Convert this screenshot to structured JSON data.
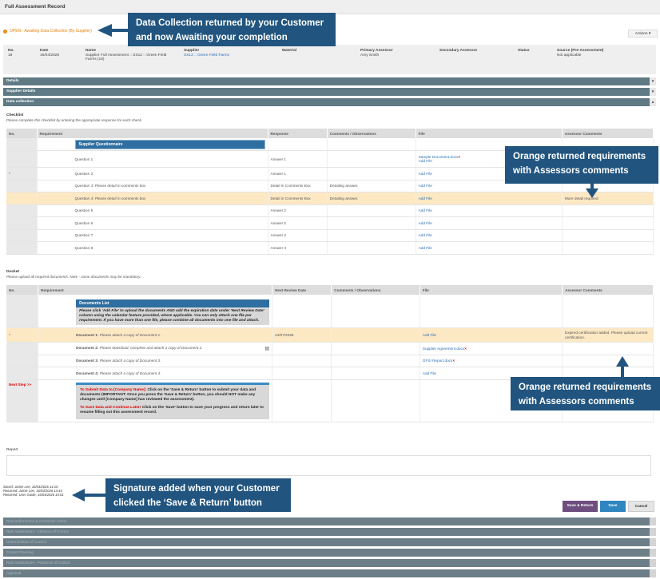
{
  "header": {
    "title": "Full Assessment Record"
  },
  "status": {
    "icon": "info-icon",
    "text": "OPEN - Awaiting Data Collection (By Supplier)"
  },
  "actions_label": "Actions ▾",
  "summary": {
    "no_label": "No.",
    "no_value": "18",
    "date_label": "Date",
    "date_value": "16/04/2026",
    "name_label": "Name",
    "name_value": "Supplier Full Assessment :: SS12 :: Green Field Farms (18)",
    "supplier_label": "Supplier",
    "supplier_value": "SS12 :: Green Field Farms",
    "material_label": "Material",
    "primary_label": "Primary Assessor",
    "primary_value": "Amy Smith",
    "secondary_label": "Secondary Assessor",
    "status_label": "Status",
    "source_label": "Source (Pre-Assessment)",
    "source_value": "Not applicable"
  },
  "sections": {
    "details": "Details",
    "supplier": "Supplier Details",
    "data": "Data collection"
  },
  "checklist": {
    "title": "Checklist",
    "hint": "Please complete this checklist by entering the appropriate response for each check.",
    "headers": [
      "No.",
      "Requirement",
      "Response",
      "Comments / Observations",
      "File",
      "Assessor Comments"
    ],
    "group": "Supplier Questionnaire",
    "rows": [
      {
        "req": "Question 1",
        "resp": "Answer 1",
        "comm": "",
        "file": "Sample Document.docx",
        "add": "Add File",
        "ac": ""
      },
      {
        "req": "Question 2",
        "resp": "Answer 1",
        "comm": "",
        "file": "",
        "add": "Add File",
        "ac": ""
      },
      {
        "req": "Question 3: Please detail in comments box",
        "resp": "Detail in Comments Box",
        "comm": "Detailing answer.",
        "file": "",
        "add": "Add File",
        "ac": ""
      },
      {
        "req": "Question 4: Please detail in comments box",
        "resp": "Detail in Comments Box",
        "comm": "Detailing answer.",
        "file": "",
        "add": "Add File",
        "ac": "More detail required"
      },
      {
        "req": "Question 5",
        "resp": "Answer 2",
        "comm": "",
        "file": "",
        "add": "Add File",
        "ac": ""
      },
      {
        "req": "Question 6",
        "resp": "Answer 2",
        "comm": "",
        "file": "",
        "add": "Add File",
        "ac": ""
      },
      {
        "req": "Question 7",
        "resp": "Answer 2",
        "comm": "",
        "file": "",
        "add": "Add File",
        "ac": ""
      },
      {
        "req": "Question 8",
        "resp": "Answer 3",
        "comm": "",
        "file": "",
        "add": "Add File",
        "ac": ""
      }
    ]
  },
  "docket": {
    "title": "Docket",
    "hint": "Please upload all required documents. Note - some documents may be mandatory.",
    "headers": [
      "No.",
      "Requirement",
      "Next Review Date",
      "Comments / Observations",
      "File",
      "Assessor Comments"
    ],
    "list_title": "Documents List",
    "list_body": "Please click 'Add File' to upload the documents AND add the expiration date under 'Next Review Date' column using the calendar feature provided, where applicable. You can only attach one file per requirement. If you have more than one file, please combine all documents into one file and attach.",
    "rows": [
      {
        "req_b": "Document 1:",
        "req": " Please attach a copy of Document 1.",
        "date": "24/07/2026",
        "file": "",
        "add": "Add File",
        "ac": "Expired certification added. Please upload current certification."
      },
      {
        "req_b": "Document 2:",
        "req": " Please download, complete and attach a copy of Document 2.",
        "date": "",
        "file": "Supplier Agreement.docx",
        "add": "",
        "ac": ""
      },
      {
        "req_b": "Document 3:",
        "req": " Please attach a copy of Document 3.",
        "date": "",
        "file": "GFSI Report.docx",
        "add": "",
        "ac": ""
      },
      {
        "req_b": "Document 4:",
        "req": " Please attach a copy of Document 4.",
        "date": "",
        "file": "",
        "add": "Add File",
        "ac": ""
      }
    ],
    "next_step": "Next Step >>",
    "next_p1_red": "To Submit Data to [Company Name]:",
    "next_p1": " Click on the 'Save & Return' button to submit your data and documents (IMPORTANT: Once you press the 'Save & Return' button, you should NOT make any changes until [Company Name] has reviewed the assessment).",
    "next_p2_red": "To Save Data and Continue Later!",
    "next_p2": " Click on the 'Save' button to save your progress and return later to resume filling out this assessment record."
  },
  "report_label": "Report",
  "saved": [
    "Saved: Jamie Lee, 16/04/2026 14:10",
    "Returned: Jamie Lee, 16/04/2026 14:44",
    "Returned: User Guide, 16/04/2026 15:01"
  ],
  "buttons": {
    "save_return": "Save & Return",
    "save": "Save",
    "cancel": "Cancel"
  },
  "bottom_sections": [
    "Nonconformance & Corrective Action",
    "Risk Assessment - Absence of Control",
    "Determination of Control",
    "Control Planning",
    "Risk Assessment - Presence of Control",
    "Approval"
  ],
  "callouts": {
    "c1": [
      "Data Collection returned by your Customer",
      "and now Awaiting your completion"
    ],
    "c2": [
      "Orange returned requirements",
      "with Assessors comments"
    ],
    "c3": [
      "Orange returned requirements",
      "with Assessors comments"
    ],
    "c4": [
      "Signature added when your Customer",
      "clicked the ‘Save & Return’ button"
    ]
  },
  "colors": {
    "accent_orange": "#fde8c4",
    "callout": "#21557f",
    "section": "#5f7a84"
  }
}
